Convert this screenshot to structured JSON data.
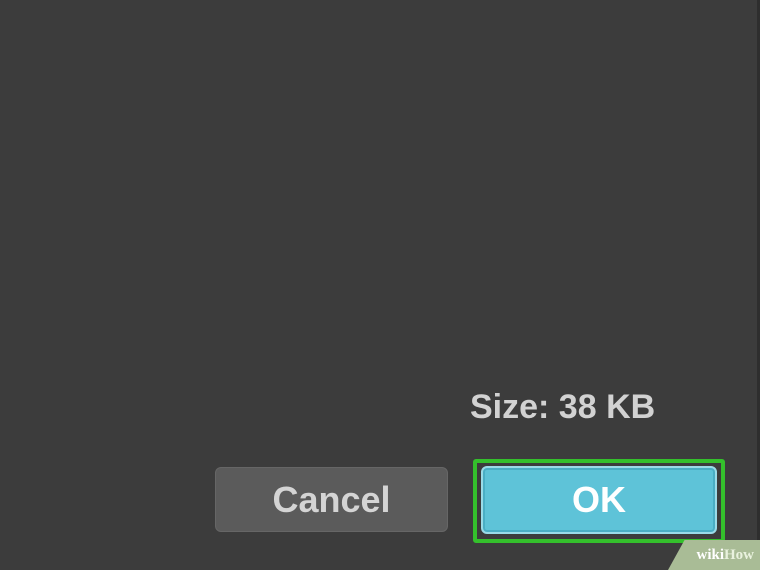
{
  "dialog": {
    "size_label": "Size: 38 KB",
    "buttons": {
      "cancel_label": "Cancel",
      "ok_label": "OK"
    }
  },
  "watermark": {
    "prefix": "wiki",
    "suffix": "How"
  },
  "colors": {
    "background": "#3c3c3c",
    "size_text": "#d2d2d2",
    "cancel_button_bg": "#5b5b5b",
    "ok_button_bg": "#5ec3d8",
    "highlight_border": "#34c02c",
    "watermark_bg": "#a9bc96"
  }
}
